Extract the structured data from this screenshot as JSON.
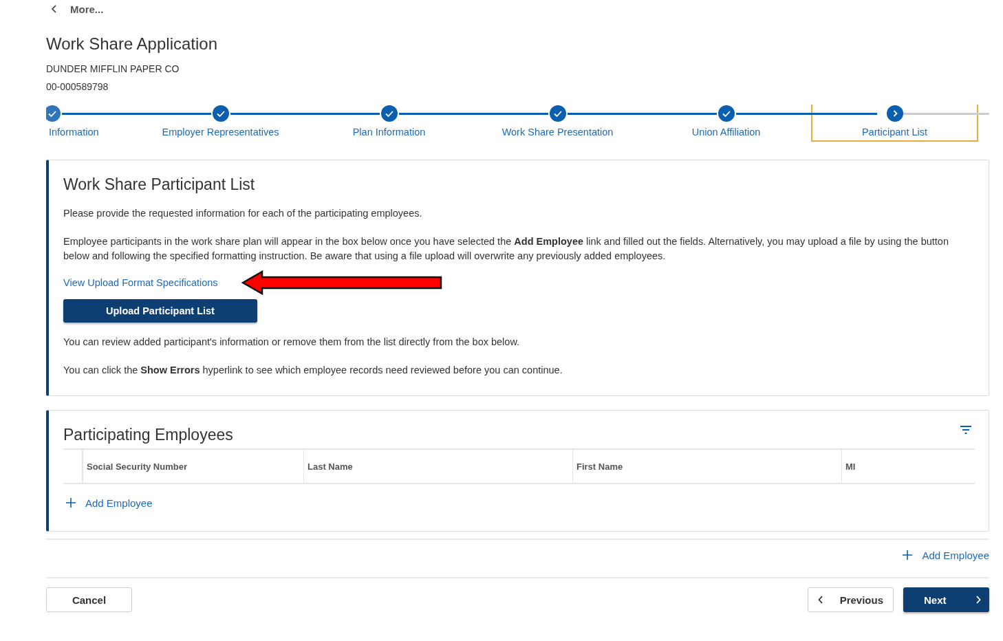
{
  "back_link": {
    "label": "More..."
  },
  "header": {
    "title": "Work Share Application",
    "employer": "DUNDER MIFFLIN PAPER CO",
    "account": "00-000589798"
  },
  "steps": [
    {
      "label": "Information",
      "completed": true,
      "selected": false
    },
    {
      "label": "Employer Representatives",
      "completed": true,
      "selected": false
    },
    {
      "label": "Plan Information",
      "completed": true,
      "selected": false
    },
    {
      "label": "Work Share Presentation",
      "completed": true,
      "selected": false
    },
    {
      "label": "Union Affiliation",
      "completed": true,
      "selected": false
    },
    {
      "label": "Participant List",
      "completed": false,
      "selected": true
    }
  ],
  "intro": {
    "title": "Work Share Participant List",
    "paragraphs": [
      "Please provide the requested information for each of the participating employees.",
      "Employee participants in the work share plan will appear in the box below once you have selected the **Add Employee** link and filled out the fields. Alternatively, you may upload a file by using the button below and following the specified formatting instruction. Be aware that using a file upload will overwrite any previously added employees."
    ],
    "spec_link": "View Upload Format Specifications",
    "upload_button": "Upload Participant List",
    "notes": [
      "You can review added participant's information or remove them from the list directly from the box below.",
      "You can click the **Show Errors** hyperlink to see which employee records need reviewed before you can continue."
    ]
  },
  "employees": {
    "title": "Participating Employees",
    "columns": [
      "Social Security Number",
      "Last Name",
      "First Name",
      "MI"
    ],
    "add_link": "Add Employee"
  },
  "add_link": "Add Employee",
  "buttons": {
    "cancel": "Cancel",
    "previous": "Previous",
    "next": "Next"
  }
}
